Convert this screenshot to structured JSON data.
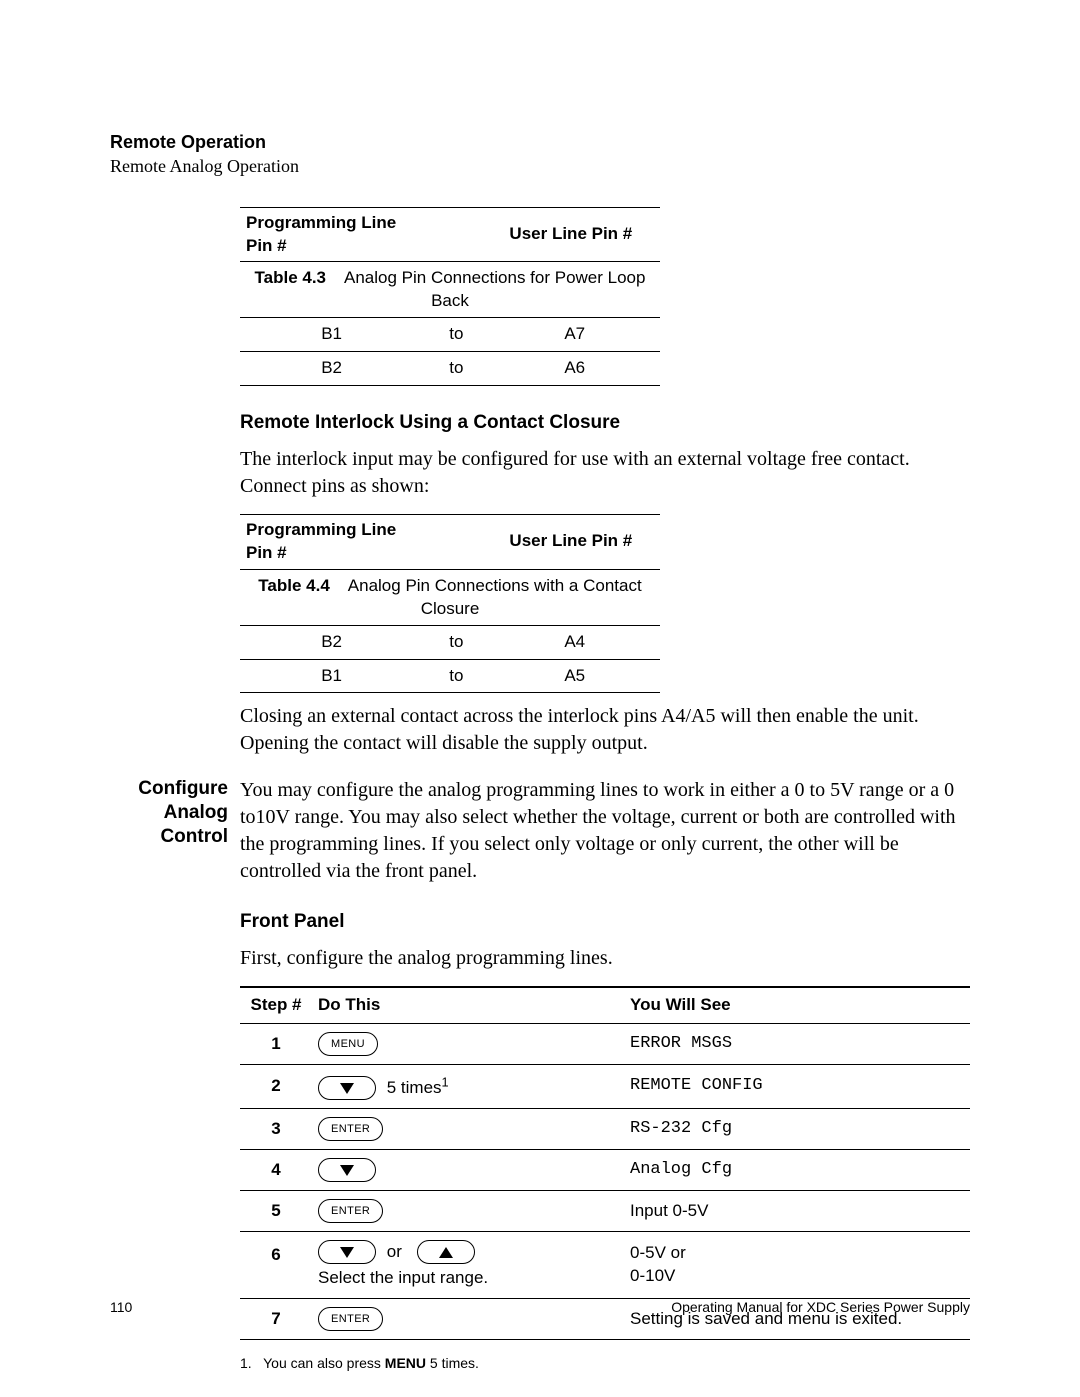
{
  "header": {
    "title": "Remote Operation",
    "subtitle": "Remote Analog Operation"
  },
  "table43": {
    "number": "Table 4.3",
    "caption": "Analog Pin Connections for Power Loop Back",
    "head": {
      "left": "Programming Line Pin #",
      "mid": "",
      "right": "User Line Pin #"
    },
    "rows": [
      {
        "l": "B1",
        "m": "to",
        "r": "A7"
      },
      {
        "l": "B2",
        "m": "to",
        "r": "A6"
      }
    ]
  },
  "interlock": {
    "heading": "Remote Interlock Using a Contact Closure",
    "p1": "The interlock input may be configured for use with an external voltage free contact. Connect pins as shown:"
  },
  "table44": {
    "number": "Table 4.4",
    "caption": "Analog Pin Connections with a Contact Closure",
    "head": {
      "left": "Programming Line Pin #",
      "mid": "",
      "right": "User Line Pin #"
    },
    "rows": [
      {
        "l": "B2",
        "m": "to",
        "r": "A4"
      },
      {
        "l": "B1",
        "m": "to",
        "r": "A5"
      }
    ]
  },
  "interlock_p2": "Closing an external contact across the interlock pins A4/A5 will then enable the unit. Opening the contact will disable the supply output.",
  "configure": {
    "label": "Configure Analog Control",
    "p1": "You may configure the analog programming lines to work in either a 0 to 5V range or a 0 to10V range. You may also select whether the voltage, current or both are controlled with the programming lines. If you select only voltage or only current, the other will be controlled via the front panel."
  },
  "frontpanel": {
    "heading": "Front Panel",
    "intro": "First, configure the analog programming lines."
  },
  "steps": {
    "head": {
      "step": "Step #",
      "do": "Do This",
      "see": "You Will See"
    },
    "rows": [
      {
        "n": "1",
        "btn": "MENU",
        "icon": "text",
        "after": "",
        "see": "ERROR MSGS",
        "see_mono": true
      },
      {
        "n": "2",
        "btn": "",
        "icon": "down",
        "after": "5 times",
        "sup": "1",
        "see": "REMOTE CONFIG",
        "see_mono": true
      },
      {
        "n": "3",
        "btn": "ENTER",
        "icon": "text",
        "after": "",
        "see": "RS-232 Cfg",
        "see_mono": true
      },
      {
        "n": "4",
        "btn": "",
        "icon": "down",
        "after": "",
        "see": "Analog Cfg",
        "see_mono": true
      },
      {
        "n": "5",
        "btn": "ENTER",
        "icon": "text",
        "after": "",
        "see": "Input 0-5V",
        "see_mono": false
      },
      {
        "n": "6",
        "btn": "",
        "icon": "downup",
        "after": "or",
        "note": "Select the input range.",
        "see": "0-5V or\n0-10V",
        "see_mono": false
      },
      {
        "n": "7",
        "btn": "ENTER",
        "icon": "text",
        "after": "",
        "see": "Setting is saved and menu is exited.",
        "see_mono": false
      }
    ]
  },
  "footnote": {
    "num": "1.",
    "pre": "You can also press ",
    "bold": "MENU",
    "post": " 5 times."
  },
  "footer": {
    "page": "110",
    "text": "Operating Manual for XDC Series Power Supply"
  }
}
